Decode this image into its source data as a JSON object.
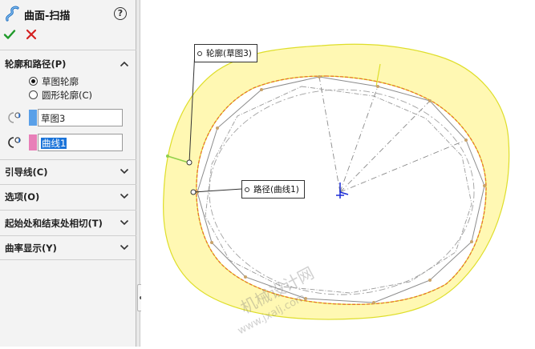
{
  "header": {
    "title": "曲面-扫描",
    "help_label": "?"
  },
  "actions": {
    "ok": "check-icon",
    "cancel": "close-icon"
  },
  "sections": {
    "profile_path": {
      "title": "轮廓和路径(P)",
      "options": [
        {
          "label": "草图轮廓",
          "selected": true
        },
        {
          "label": "圆形轮廓(C)",
          "selected": false
        }
      ],
      "profile_value": "草图3",
      "path_value": "曲线1",
      "profile_color": "#5aa0e8",
      "path_color": "#e87fb8"
    },
    "guide_curves": {
      "title": "引导线(C)"
    },
    "options": {
      "title": "选项(O)"
    },
    "start_end": {
      "title": "起始处和结束处相切(T)"
    },
    "curvature": {
      "title": "曲率显示(Y)"
    }
  },
  "viewport": {
    "callout_profile": "轮廓(草图3)",
    "callout_path": "路径(曲线1)",
    "watermark": "机械设计网",
    "watermark_url": "www.jxalj.com",
    "surface_color": "#fff7a0",
    "surface_edge_color": "#d8d800",
    "path_color": "#e8742a",
    "origin_color": "#1a2bd6"
  }
}
